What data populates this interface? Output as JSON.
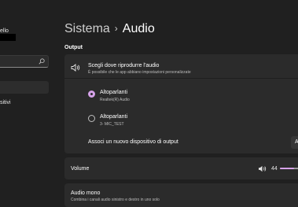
{
  "sidebar": {
    "user_name_fragment": "ello",
    "search_placeholder": "",
    "partial_item": "sitivi"
  },
  "breadcrumb": {
    "parent": "Sistema",
    "separator": "›",
    "current": "Audio"
  },
  "output": {
    "section_title": "Output",
    "header_title": "Scegli dove riprodurre l'audio",
    "header_sub": "È possibile che le app abbiano impostazioni personalizzate",
    "devices": [
      {
        "name": "Altoparlanti",
        "sub": "Realtek(R) Audio",
        "selected": true
      },
      {
        "name": "Altoparlanti",
        "sub": "3- MIC_TEST",
        "selected": false
      }
    ],
    "add_device_label": "Associ un nuovo dispositivo di output",
    "add_button_label": "A"
  },
  "volume": {
    "label": "Volume",
    "value": "44",
    "level": 0.44
  },
  "mono": {
    "title": "Audio mono",
    "sub": "Combina i canali audio sinistro e destro in uno solo"
  },
  "colors": {
    "accent": "#d5a2e8",
    "background": "#202020",
    "card": "#2b2b2b"
  },
  "icons": {
    "search": "search-icon",
    "speaker": "speaker-icon",
    "volume": "volume-icon"
  }
}
